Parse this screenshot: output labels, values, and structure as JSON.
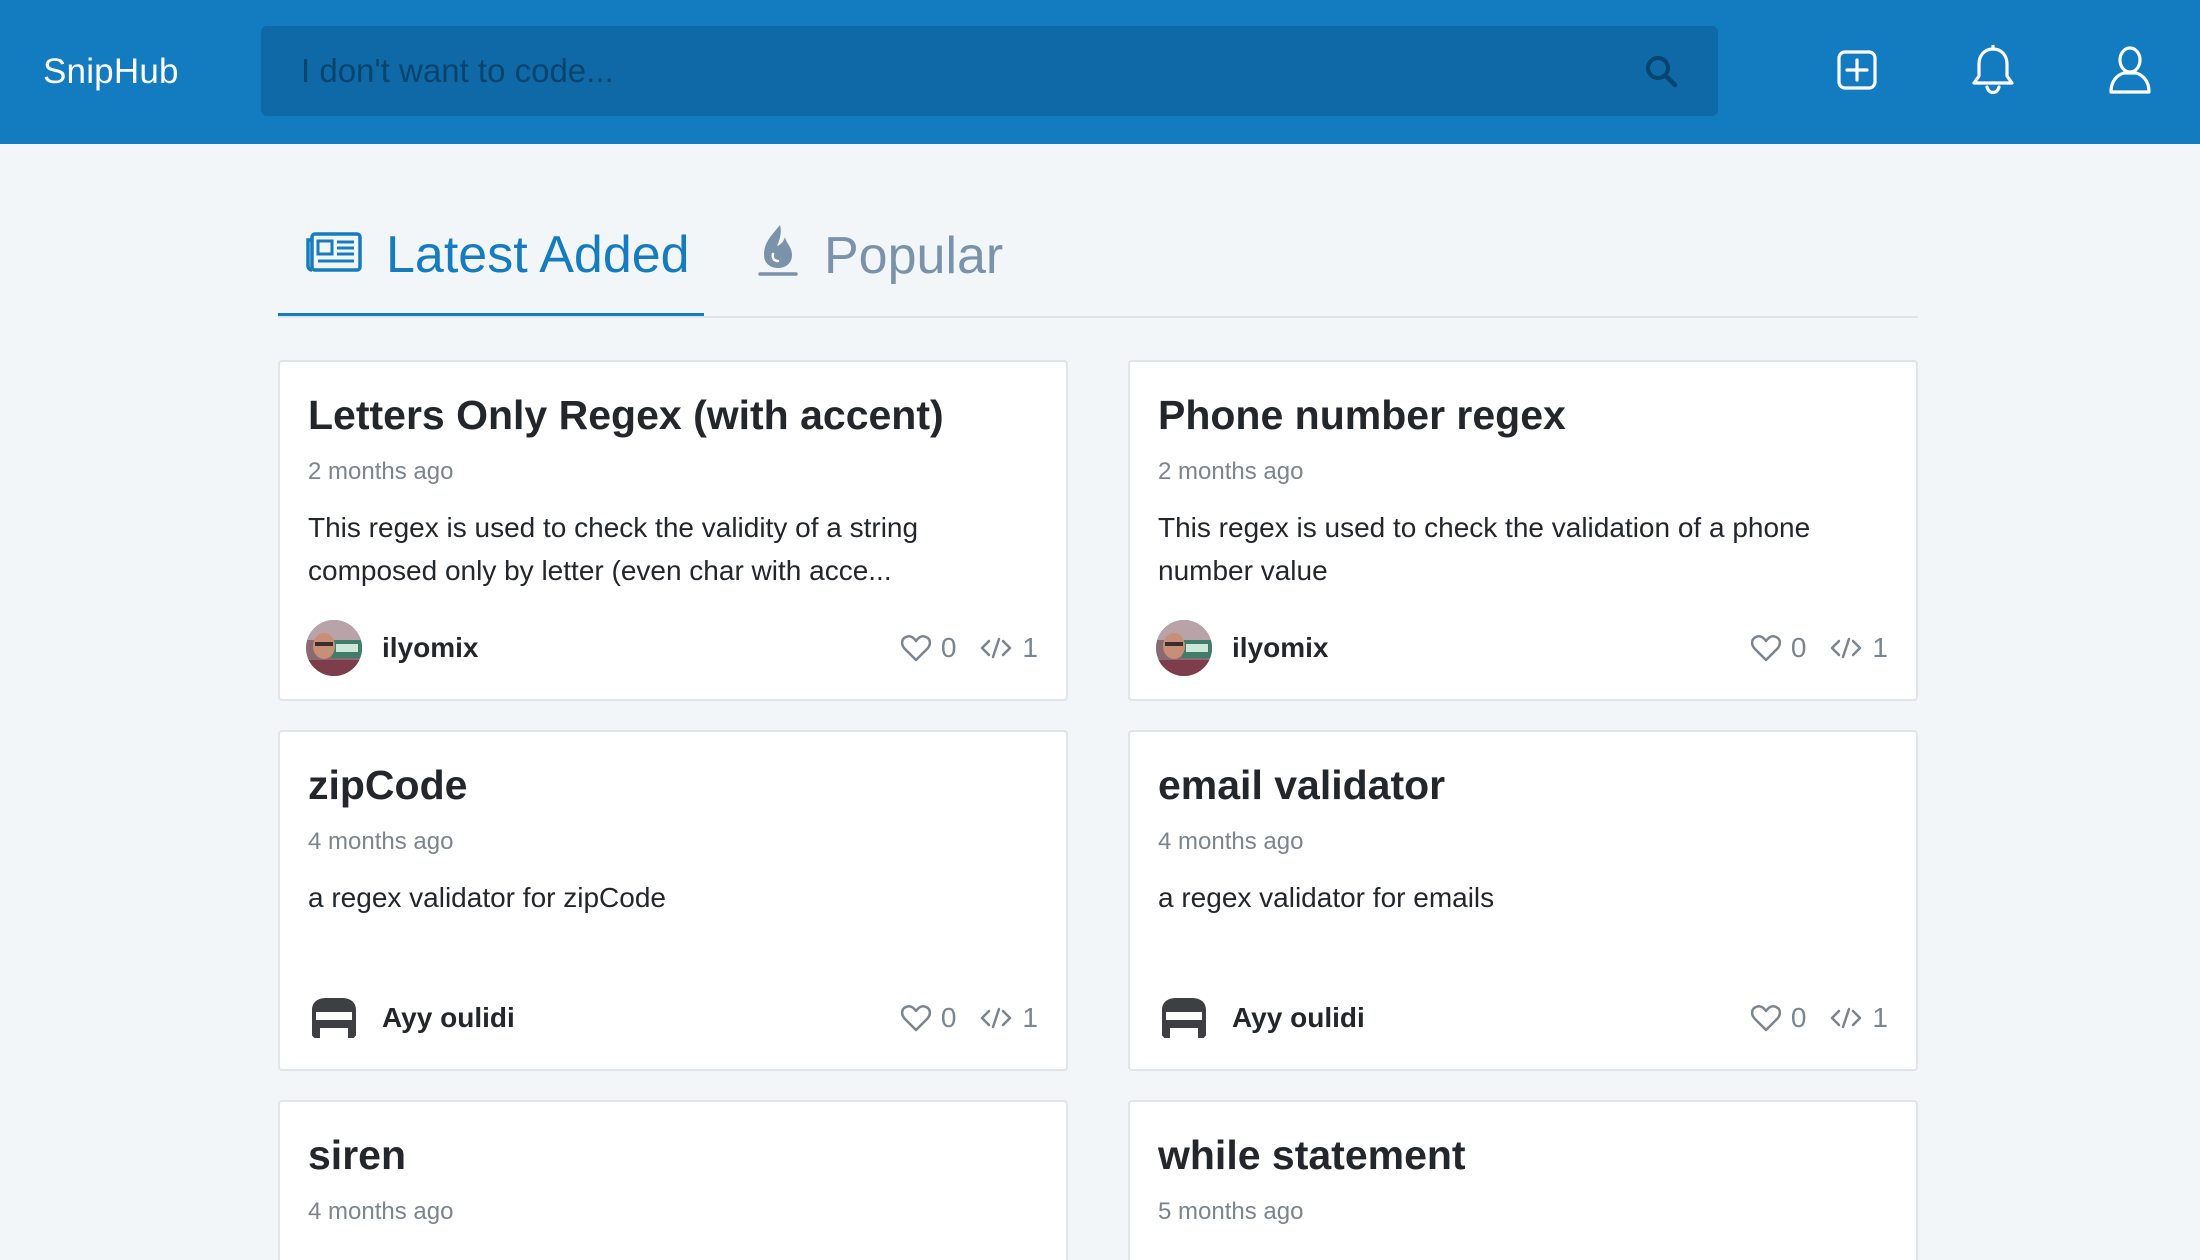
{
  "header": {
    "brand": "SnipHub",
    "search_placeholder": "I don't want to code...",
    "icons": [
      "search-icon",
      "add-square-icon",
      "bell-icon",
      "user-icon"
    ],
    "bg_color": "#137bbf"
  },
  "tabs": [
    {
      "label": "Latest Added",
      "icon": "newspaper-icon",
      "active": true
    },
    {
      "label": "Popular",
      "icon": "flame-icon",
      "active": false
    }
  ],
  "cards": [
    {
      "title": "Letters Only Regex (with accent)",
      "date": "2 months ago",
      "description": "This regex is used to check the validity of a string composed only by letter (even char with acce...",
      "author": "ilyomix",
      "avatar": "photo",
      "likes": "0",
      "snippets": "1"
    },
    {
      "title": "Phone number regex",
      "date": "2 months ago",
      "description": "This regex is used to check the validation of a phone number value",
      "author": "ilyomix",
      "avatar": "photo",
      "likes": "0",
      "snippets": "1"
    },
    {
      "title": "zipCode",
      "date": "4 months ago",
      "description": "a regex validator for zipCode",
      "author": "Ayy oulidi",
      "avatar": "logo",
      "likes": "0",
      "snippets": "1"
    },
    {
      "title": "email validator",
      "date": "4 months ago",
      "description": "a regex validator for emails",
      "author": "Ayy oulidi",
      "avatar": "logo",
      "likes": "0",
      "snippets": "1"
    },
    {
      "title": "siren",
      "date": "4 months ago"
    },
    {
      "title": "while statement",
      "date": "5 months ago"
    }
  ],
  "colors": {
    "accent": "#147cbf",
    "muted_tab": "#7b93aa",
    "page_bg": "#f3f6f8"
  }
}
